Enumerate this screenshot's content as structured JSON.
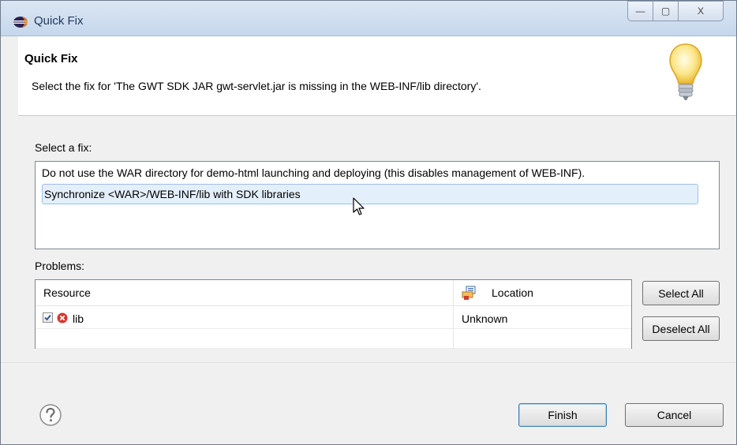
{
  "window": {
    "title": "Quick Fix",
    "min_glyph": "—",
    "max_glyph": "▢",
    "close_glyph": "X"
  },
  "header": {
    "title": "Quick Fix",
    "message": "Select the fix for 'The GWT SDK JAR gwt-servlet.jar is missing in the WEB-INF/lib directory'."
  },
  "fix_section": {
    "label": "Select a fix:",
    "items": [
      "Do not use the WAR directory for demo-html launching and deploying (this disables management of WEB-INF).",
      "Synchronize <WAR>/WEB-INF/lib with SDK libraries"
    ],
    "selected_index": 1
  },
  "problems_section": {
    "label": "Problems:",
    "columns": {
      "resource": "Resource",
      "location": "Location"
    },
    "rows": [
      {
        "resource": "lib",
        "location": "Unknown",
        "checked": true,
        "icon": "error-icon"
      }
    ]
  },
  "buttons": {
    "select_all": "Select All",
    "deselect_all": "Deselect All",
    "finish": "Finish",
    "cancel": "Cancel"
  },
  "icons": {
    "app": "eclipse-icon",
    "header": "lightbulb-icon",
    "help": "help-icon"
  }
}
